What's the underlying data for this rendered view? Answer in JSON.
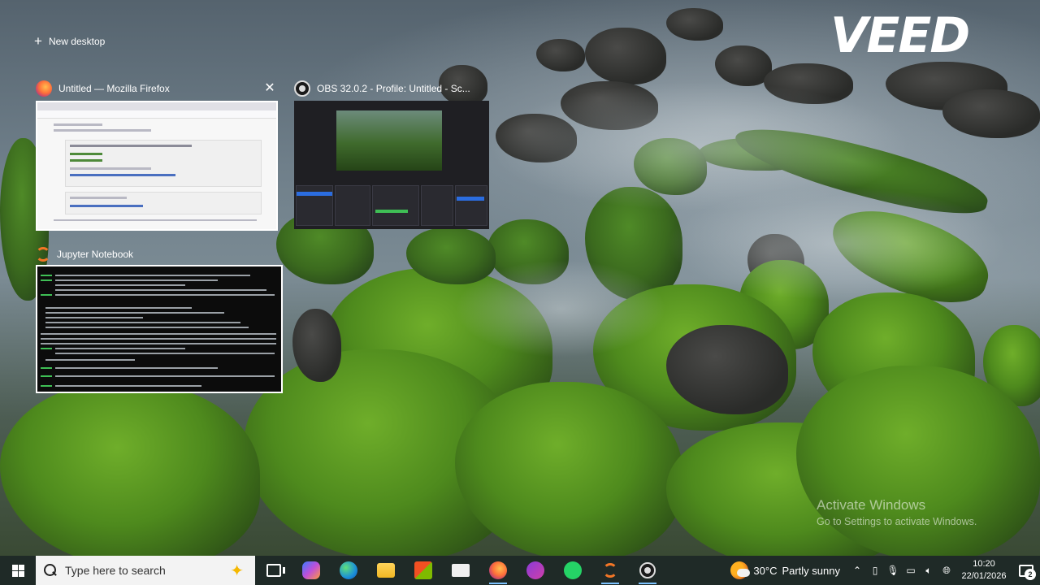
{
  "desktop": {
    "new_desktop_label": "New desktop",
    "watermark_logo": "VEED",
    "activation": {
      "title": "Activate Windows",
      "subtitle": "Go to Settings to activate Windows."
    }
  },
  "task_windows": [
    {
      "title": "Untitled — Mozilla Firefox",
      "icon": "firefox-icon",
      "close_glyph": "✕"
    },
    {
      "title": "OBS 32.0.2 - Profile: Untitled - Sc...",
      "icon": "obs-icon"
    },
    {
      "title": "Jupyter Notebook",
      "icon": "jupyter-icon"
    }
  ],
  "taskbar": {
    "search_placeholder": "Type here to search",
    "pinned_apps": [
      {
        "name": "task-view",
        "icon": "task-view-icon"
      },
      {
        "name": "copilot",
        "icon": "copilot-icon"
      },
      {
        "name": "edge",
        "icon": "edge-icon"
      },
      {
        "name": "file-explorer",
        "icon": "folder-icon"
      },
      {
        "name": "microsoft-store",
        "icon": "store-icon"
      },
      {
        "name": "mail",
        "icon": "mail-icon"
      },
      {
        "name": "firefox",
        "icon": "firefox-icon",
        "active": true
      },
      {
        "name": "game-app",
        "icon": "gamepad-icon"
      },
      {
        "name": "whatsapp",
        "icon": "whatsapp-icon"
      },
      {
        "name": "jupyter",
        "icon": "jupyter-icon",
        "active": true
      },
      {
        "name": "obs",
        "icon": "obs-icon",
        "active": true
      }
    ],
    "weather": {
      "temperature": "30°C",
      "condition": "Partly sunny"
    },
    "clock": {
      "time": "10:20",
      "date": "22/01/2026"
    },
    "notification_count": "2"
  },
  "colors": {
    "taskbar": "#1f2a27",
    "accent": "#7dc3ff",
    "moss": "#5e9e24"
  }
}
